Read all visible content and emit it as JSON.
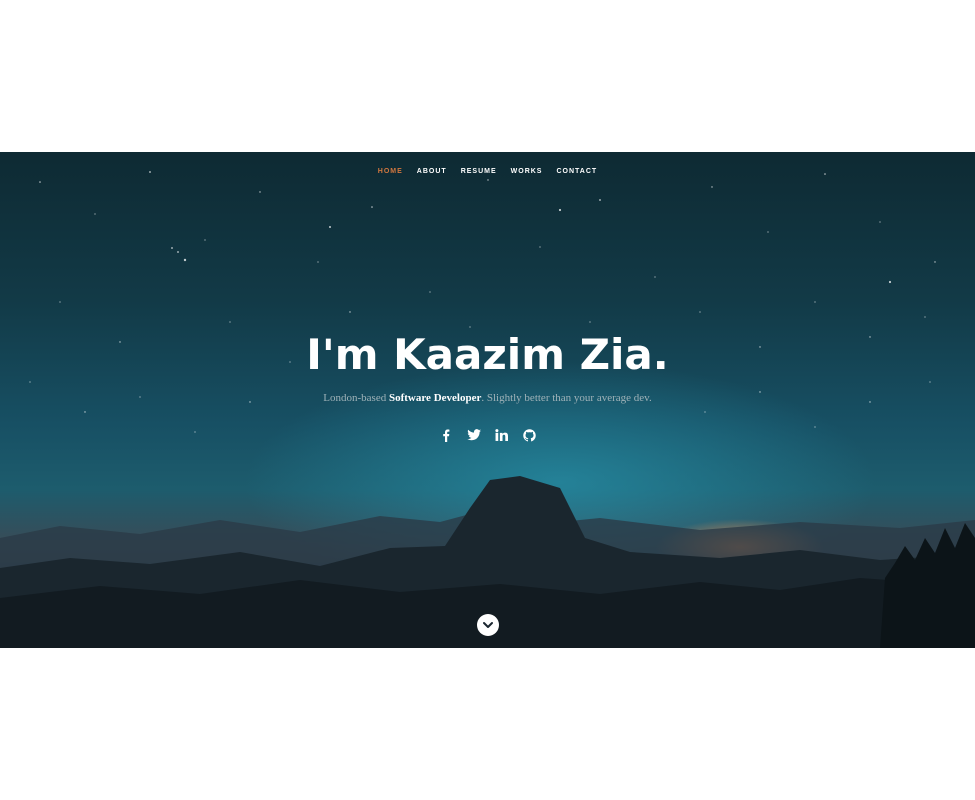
{
  "nav": {
    "items": [
      {
        "label": "Home",
        "active": true
      },
      {
        "label": "About",
        "active": false
      },
      {
        "label": "Resume",
        "active": false
      },
      {
        "label": "Works",
        "active": false
      },
      {
        "label": "Contact",
        "active": false
      }
    ]
  },
  "banner": {
    "headline": "I'm Kaazim Zia.",
    "tagline_prefix": "London-based ",
    "tagline_strong": "Software Developer",
    "tagline_suffix": ". Slightly better than your average dev."
  },
  "social": {
    "icons": [
      "facebook-icon",
      "twitter-icon",
      "linkedin-icon",
      "github-icon"
    ]
  },
  "scroll": {
    "icon": "chevron-down-icon"
  },
  "colors": {
    "accent": "#d1773f",
    "text": "#ffffff",
    "sky_dark": "#0e2a33",
    "sky_mid": "#175064",
    "glow": "#ff9650"
  }
}
